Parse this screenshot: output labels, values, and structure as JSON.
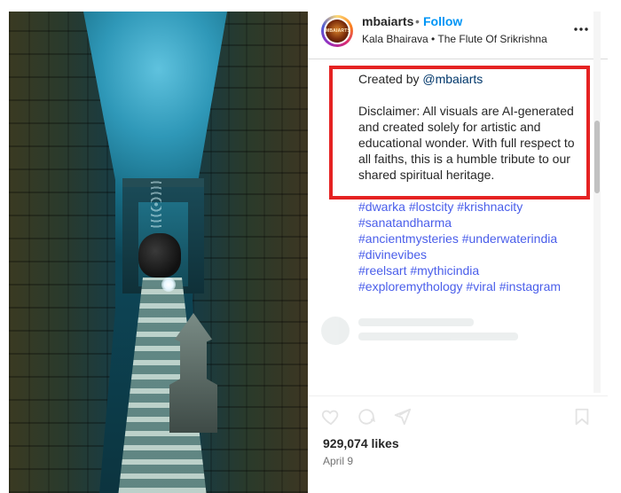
{
  "post": {
    "username": "mbaiarts",
    "separator": "•",
    "follow_label": "Follow",
    "audio": "Kala Bhairava • The Flute Of Srikrishna",
    "avatar_text": "MBAIARTS",
    "more_icon": "more-horizontal-icon",
    "accent_color": "#0095f6"
  },
  "caption": {
    "created_by_prefix": "Created by ",
    "created_by_handle": "@mbaiarts",
    "disclaimer": "Disclaimer: All visuals are AI-generated and created solely for artistic and educational wonder. With full respect to all faiths, this is a humble tribute to our shared spiritual heritage.",
    "highlight_color": "#e52222"
  },
  "hashtags": {
    "line1": [
      "#dwarka",
      "#lostcity",
      "#krishnacity"
    ],
    "line2": [
      "#sanatandharma"
    ],
    "line3": [
      "#ancientmysteries",
      "#underwaterindia"
    ],
    "line4": [
      "#divinevibes"
    ],
    "line5": [
      "#reelsart",
      "#mythicindia"
    ],
    "line6": [
      "#exploremythology",
      "#viral",
      "#instagram"
    ],
    "color": "#4a5eea"
  },
  "stats": {
    "likes": "929,074 likes",
    "date": "April 9"
  },
  "actions": {
    "icons": [
      "heart-icon",
      "comment-icon",
      "share-icon",
      "bookmark-icon"
    ]
  }
}
